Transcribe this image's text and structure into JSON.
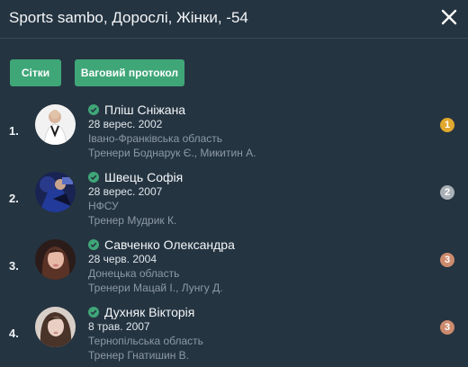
{
  "modal": {
    "title": "Sports sambo, Дорослі, Жінки, -54"
  },
  "toolbar": {
    "grids_label": "Сітки",
    "protocol_label": "Ваговий протокол"
  },
  "athletes": [
    {
      "place": "1.",
      "name": "Пліш Сніжана",
      "dob": "28 верес. 2002",
      "region": "Івано-Франківська область",
      "coaches": "Тренери Боднарук Є.,  Микитин А.",
      "medal": "1",
      "medal_color": "#e0a82e"
    },
    {
      "place": "2.",
      "name": "Швець Софія",
      "dob": "28 верес. 2007",
      "region": "НФСУ",
      "coaches": "Тренер Мудрик К.",
      "medal": "2",
      "medal_color": "#a9b0b6"
    },
    {
      "place": "3.",
      "name": "Савченко Олександра",
      "dob": "28 черв. 2004",
      "region": "Донецька область",
      "coaches": "Тренери Мацай І.,  Лунгу Д.",
      "medal": "3",
      "medal_color": "#cd8b6e"
    },
    {
      "place": "4.",
      "name": "Духняк Вікторія",
      "dob": "8 трав. 2007",
      "region": "Тернопільська область",
      "coaches": "Тренер Гнатишин В.",
      "medal": "3",
      "medal_color": "#cd8b6e"
    }
  ],
  "colors": {
    "background": "#253441",
    "accent": "#3fa678",
    "verified": "#3fa678"
  },
  "icons": {
    "close": "close-icon",
    "verified": "verified-check-icon"
  }
}
